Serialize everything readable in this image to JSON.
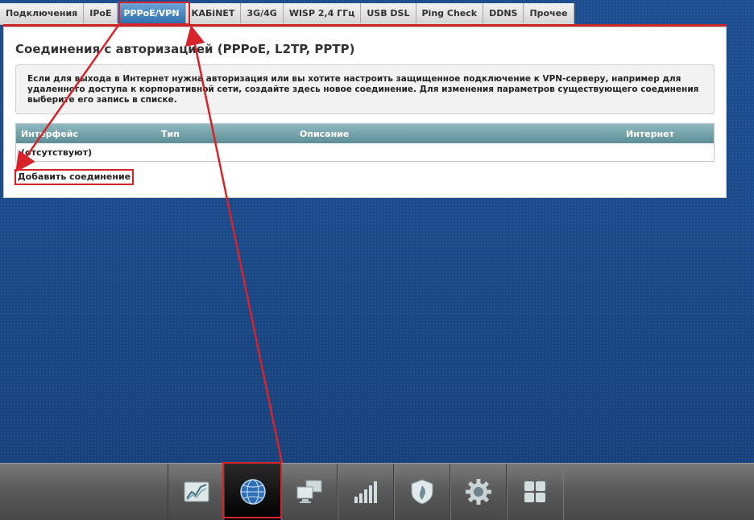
{
  "tabs": [
    {
      "label": "Подключения",
      "active": false
    },
    {
      "label": "IPoE",
      "active": false
    },
    {
      "label": "PPPoE/VPN",
      "active": true
    },
    {
      "label": "КАБiNET",
      "active": false
    },
    {
      "label": "3G/4G",
      "active": false
    },
    {
      "label": "WISP 2,4 ГГц",
      "active": false
    },
    {
      "label": "USB DSL",
      "active": false
    },
    {
      "label": "Ping Check",
      "active": false
    },
    {
      "label": "DDNS",
      "active": false
    },
    {
      "label": "Прочее",
      "active": false
    }
  ],
  "panel": {
    "title": "Соединения с авторизацией (PPPoE, L2TP, PPTP)",
    "info_line1": "Если для выхода в Интернет нужна авторизация или вы хотите настроить защищенное подключение к VPN-серверу, например для",
    "info_line2": "удаленного доступа к корпоративной сети, создайте здесь новое соединение. Для изменения параметров существующего соединения",
    "info_line3": "выберите его запись в списке.",
    "table": {
      "headers": [
        "Интерфейс",
        "Тип",
        "Описание",
        "Интернет"
      ],
      "empty_text": "(отсутствуют)"
    },
    "add_button": "Добавить соединение"
  },
  "bottom_nav": [
    {
      "icon": "chart-icon",
      "active": false
    },
    {
      "icon": "globe-icon",
      "active": true
    },
    {
      "icon": "computers-icon",
      "active": false
    },
    {
      "icon": "signal-bars-icon",
      "active": false
    },
    {
      "icon": "shield-icon",
      "active": false
    },
    {
      "icon": "gear-icon",
      "active": false
    },
    {
      "icon": "apps-grid-icon",
      "active": false
    }
  ],
  "colors": {
    "highlight": "#d8232a",
    "active_tab": "#2f6fb0",
    "table_header": "#6f9ca3"
  }
}
